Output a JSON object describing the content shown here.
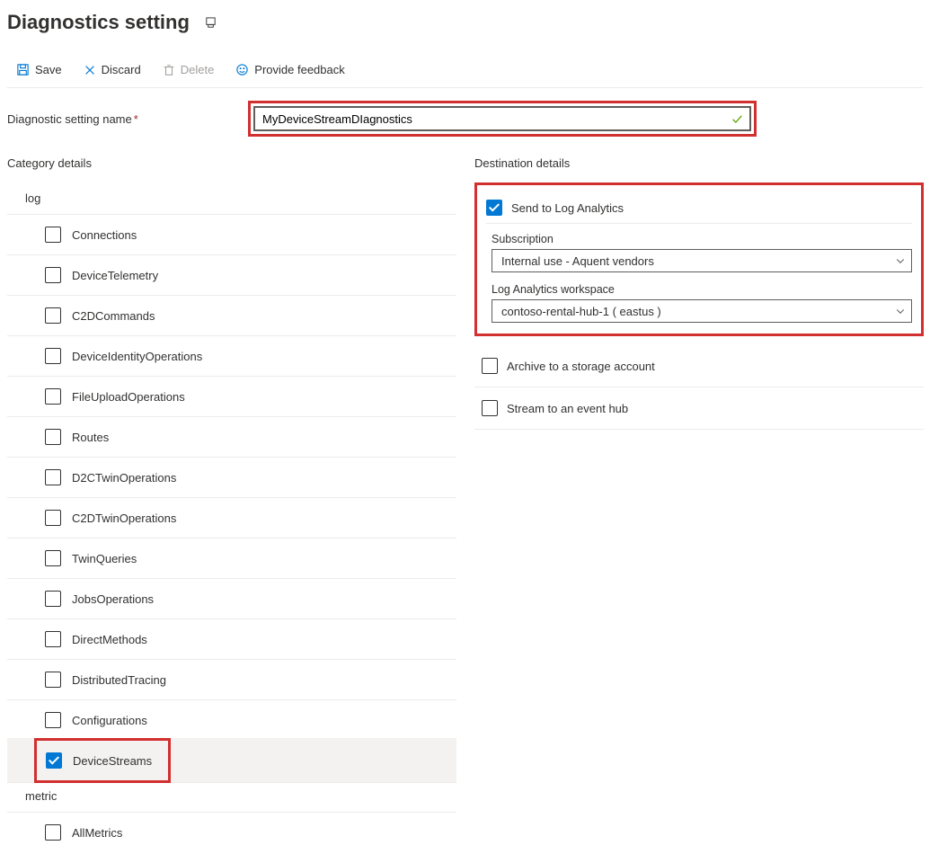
{
  "header": {
    "title": "Diagnostics setting"
  },
  "toolbar": {
    "save": "Save",
    "discard": "Discard",
    "delete": "Delete",
    "feedback": "Provide feedback"
  },
  "name_field": {
    "label": "Diagnostic setting name",
    "value": "MyDeviceStreamDIagnostics"
  },
  "category": {
    "title": "Category details",
    "group_log": "log",
    "group_metric": "metric",
    "items": [
      {
        "label": "Connections",
        "checked": false
      },
      {
        "label": "DeviceTelemetry",
        "checked": false
      },
      {
        "label": "C2DCommands",
        "checked": false
      },
      {
        "label": "DeviceIdentityOperations",
        "checked": false
      },
      {
        "label": "FileUploadOperations",
        "checked": false
      },
      {
        "label": "Routes",
        "checked": false
      },
      {
        "label": "D2CTwinOperations",
        "checked": false
      },
      {
        "label": "C2DTwinOperations",
        "checked": false
      },
      {
        "label": "TwinQueries",
        "checked": false
      },
      {
        "label": "JobsOperations",
        "checked": false
      },
      {
        "label": "DirectMethods",
        "checked": false
      },
      {
        "label": "DistributedTracing",
        "checked": false
      },
      {
        "label": "Configurations",
        "checked": false
      },
      {
        "label": "DeviceStreams",
        "checked": true
      }
    ],
    "metrics": [
      {
        "label": "AllMetrics",
        "checked": false
      }
    ]
  },
  "destination": {
    "title": "Destination details",
    "log_analytics": {
      "label": "Send to Log Analytics",
      "checked": true,
      "subscription_label": "Subscription",
      "subscription_value": "Internal use - Aquent vendors",
      "workspace_label": "Log Analytics workspace",
      "workspace_value": "contoso-rental-hub-1 ( eastus )"
    },
    "storage": {
      "label": "Archive to a storage account",
      "checked": false
    },
    "eventhub": {
      "label": "Stream to an event hub",
      "checked": false
    }
  }
}
